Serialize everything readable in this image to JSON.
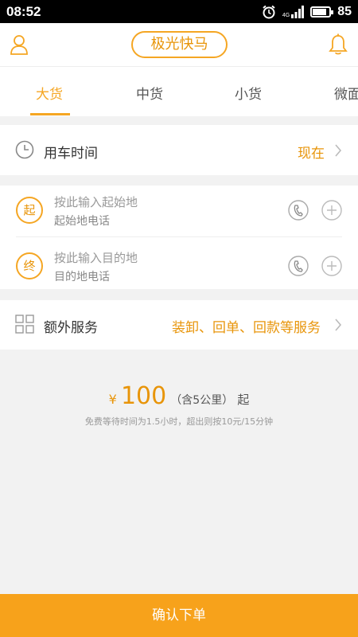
{
  "status_bar": {
    "time": "08:52",
    "network": "4G",
    "battery": "85",
    "battery_level": 0.85
  },
  "header": {
    "title": "极光快马",
    "left_icon": "user-icon",
    "right_icon": "bell-icon"
  },
  "tabs": [
    {
      "label": "大货",
      "active": true
    },
    {
      "label": "中货",
      "active": false
    },
    {
      "label": "小货",
      "active": false
    },
    {
      "label": "微面",
      "active": false
    }
  ],
  "use_time": {
    "label": "用车时间",
    "value": "现在",
    "icon": "clock-icon"
  },
  "origin": {
    "badge": "起",
    "placeholder": "按此输入起始地",
    "phone_placeholder": "起始地电话"
  },
  "destination": {
    "badge": "终",
    "placeholder": "按此输入目的地",
    "phone_placeholder": "目的地电话"
  },
  "extra_service": {
    "label": "额外服务",
    "value": "装卸、回单、回款等服务",
    "icon": "grid-icon"
  },
  "pricing": {
    "currency": "¥",
    "price": "100",
    "note": "（含5公里）",
    "suffix": "起",
    "fine_print": "免费等待时间为1.5小时，超出则按10元/15分钟"
  },
  "confirm_button": "确认下单",
  "colors": {
    "accent": "#f5a623",
    "accent_text": "#e8950a",
    "button": "#f7a21b",
    "background": "#f2f2f2"
  }
}
